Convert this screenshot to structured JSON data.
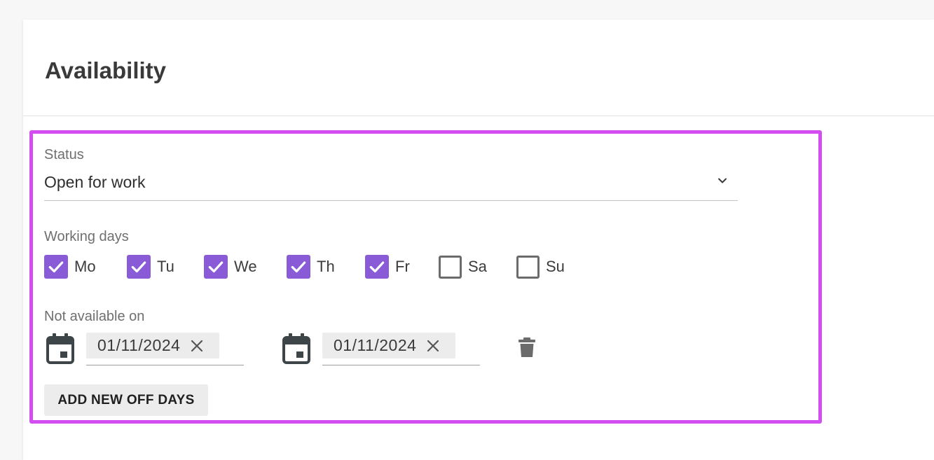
{
  "page": {
    "title": "Availability"
  },
  "status": {
    "label": "Status",
    "value": "Open for work",
    "icon": "chevron-down-icon"
  },
  "working_days": {
    "label": "Working days",
    "days": [
      {
        "label": "Mo",
        "checked": true
      },
      {
        "label": "Tu",
        "checked": true
      },
      {
        "label": "We",
        "checked": true
      },
      {
        "label": "Th",
        "checked": true
      },
      {
        "label": "Fr",
        "checked": true
      },
      {
        "label": "Sa",
        "checked": false
      },
      {
        "label": "Su",
        "checked": false
      }
    ]
  },
  "off_days": {
    "label": "Not available on",
    "range": {
      "start": "01/11/2024",
      "end": "01/11/2024"
    },
    "add_button_label": "ADD NEW OFF DAYS"
  },
  "colors": {
    "accent": "#8a5bd6",
    "highlight": "#d24ef0"
  }
}
